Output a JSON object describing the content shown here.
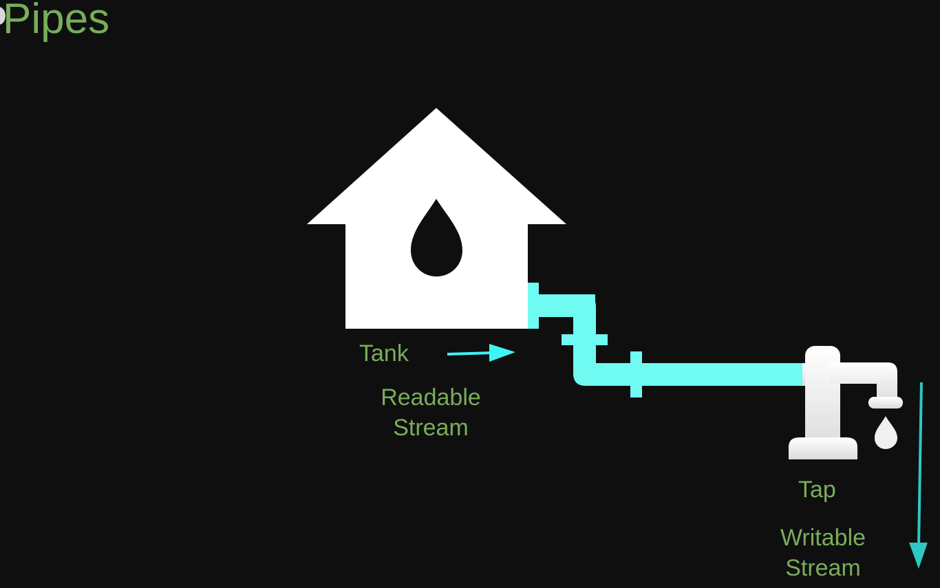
{
  "slide": {
    "title": "Pipes"
  },
  "labels": {
    "tank": "Tank",
    "readable_line1": "Readable",
    "readable_line2": "Stream",
    "tap": "Tap",
    "writable_line1": "Writable",
    "writable_line2": "Stream"
  },
  "icons": {
    "house": "house-tank-icon",
    "drop": "water-drop-icon",
    "pipe": "pipe-icon",
    "tap": "tap-faucet-icon"
  },
  "colors": {
    "background": "#0f0f10",
    "text": "#79ad5a",
    "pipe": "#6ffaf2",
    "arrow_readable": "#3ff4f4",
    "arrow_writable": "#2fc7c4",
    "tank": "#ffffff",
    "tap": "#efefef"
  }
}
